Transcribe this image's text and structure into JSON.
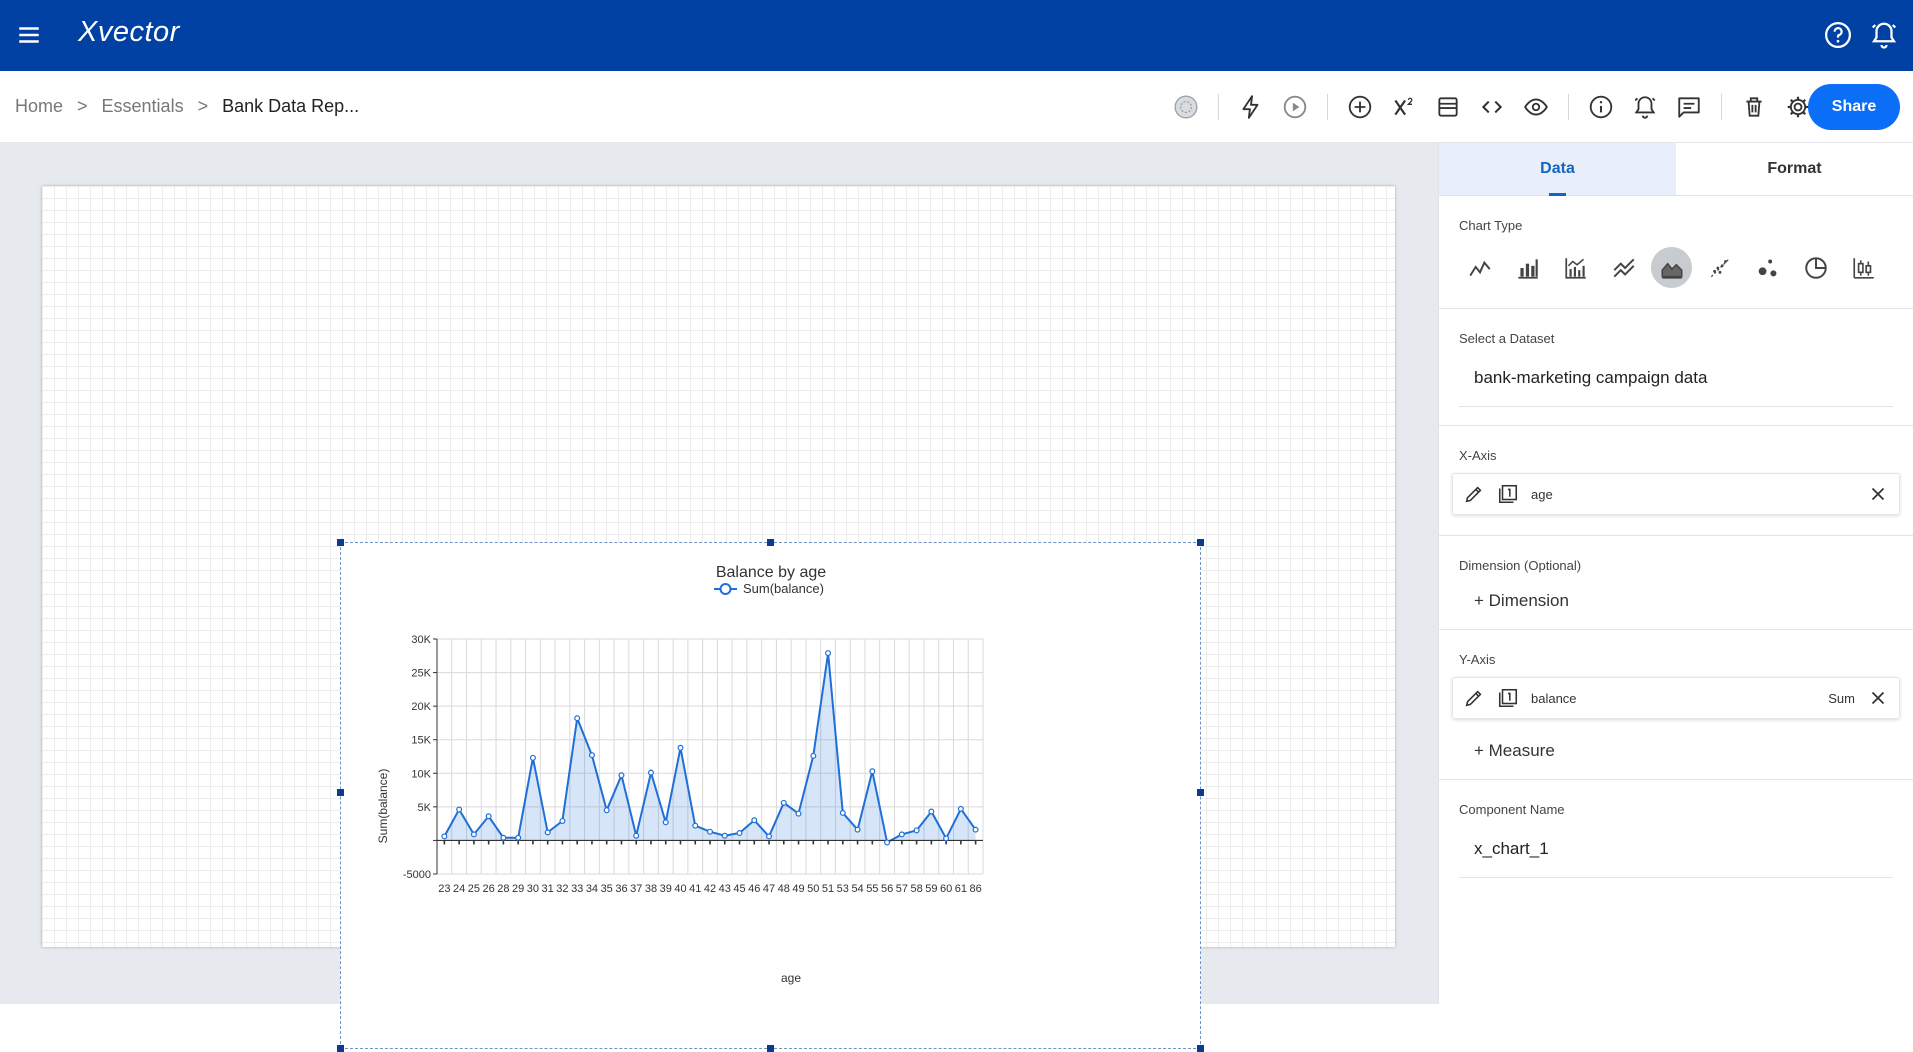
{
  "app": {
    "logo": "Xvector"
  },
  "breadcrumb": {
    "home": "Home",
    "sep1": ">",
    "section": "Essentials",
    "sep2": ">",
    "current": "Bank Data Rep..."
  },
  "toolbar": {
    "share_label": "Share"
  },
  "panel": {
    "tabs": [
      "Data",
      "Format"
    ],
    "chart_type_label": "Chart Type",
    "dataset_label": "Select a Dataset",
    "dataset_value": "bank-marketing campaign data",
    "xaxis_label": "X-Axis",
    "xaxis_field": "age",
    "dimension_label": "Dimension (Optional)",
    "dimension_add": "+ Dimension",
    "yaxis_label": "Y-Axis",
    "yaxis_field": "balance",
    "yaxis_agg": "Sum",
    "measure_add": "+ Measure",
    "component_label": "Component Name",
    "component_value": "x_chart_1"
  },
  "chart_data": {
    "type": "area",
    "title": "Balance by age",
    "xlabel": "age",
    "ylabel": "Sum(balance)",
    "legend": "top-center",
    "grid": true,
    "ylim": [
      -5000,
      30000
    ],
    "y_ticks": [
      "30K",
      "25K",
      "20K",
      "15K",
      "10K",
      "5K",
      "",
      "-5000"
    ],
    "categories": [
      "23",
      "24",
      "25",
      "26",
      "28",
      "29",
      "30",
      "31",
      "32",
      "33",
      "34",
      "35",
      "36",
      "37",
      "38",
      "39",
      "40",
      "41",
      "42",
      "43",
      "45",
      "46",
      "47",
      "48",
      "49",
      "50",
      "51",
      "53",
      "54",
      "55",
      "56",
      "57",
      "58",
      "59",
      "60",
      "61",
      "86"
    ],
    "series": [
      {
        "name": "Sum(balance)",
        "color": "#1f6fd8",
        "values": [
          600,
          4600,
          900,
          3600,
          400,
          400,
          12300,
          1200,
          2900,
          18200,
          12700,
          4500,
          9700,
          700,
          10100,
          2700,
          13800,
          2200,
          1300,
          700,
          1100,
          3000,
          600,
          5600,
          4000,
          12600,
          27900,
          4100,
          1600,
          10300,
          -300,
          900,
          1500,
          4300,
          300,
          4700,
          1600
        ]
      }
    ]
  }
}
